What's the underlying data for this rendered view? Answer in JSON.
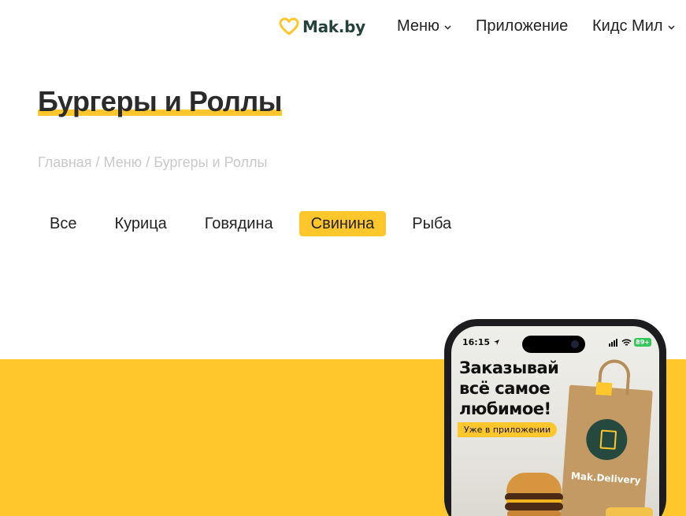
{
  "header": {
    "logo_text": "Mak.by",
    "nav": [
      {
        "label": "Меню",
        "has_dropdown": true
      },
      {
        "label": "Приложение",
        "has_dropdown": false
      },
      {
        "label": "Кидс Мил",
        "has_dropdown": true
      }
    ]
  },
  "page": {
    "title": "Бургеры и Роллы",
    "breadcrumb": [
      "Главная",
      "Меню",
      "Бургеры и Роллы"
    ],
    "breadcrumb_separator": " / "
  },
  "filters": {
    "items": [
      "Все",
      "Курица",
      "Говядина",
      "Свинина",
      "Рыба"
    ],
    "active": "Свинина"
  },
  "promo": {
    "status_time": "16:15",
    "battery": "89+",
    "headline": "Заказывай\nвсё самое\nлюбимое!",
    "badge": "Уже в приложении",
    "bag_text": "Mak.Delivery"
  },
  "colors": {
    "accent": "#ffc72c",
    "logo": "#25413a",
    "breadcrumb": "#c9c9c9"
  },
  "icons": [
    "heart-logo-icon",
    "chevron-down-icon",
    "location-arrow-icon",
    "signal-icon",
    "wifi-icon"
  ]
}
